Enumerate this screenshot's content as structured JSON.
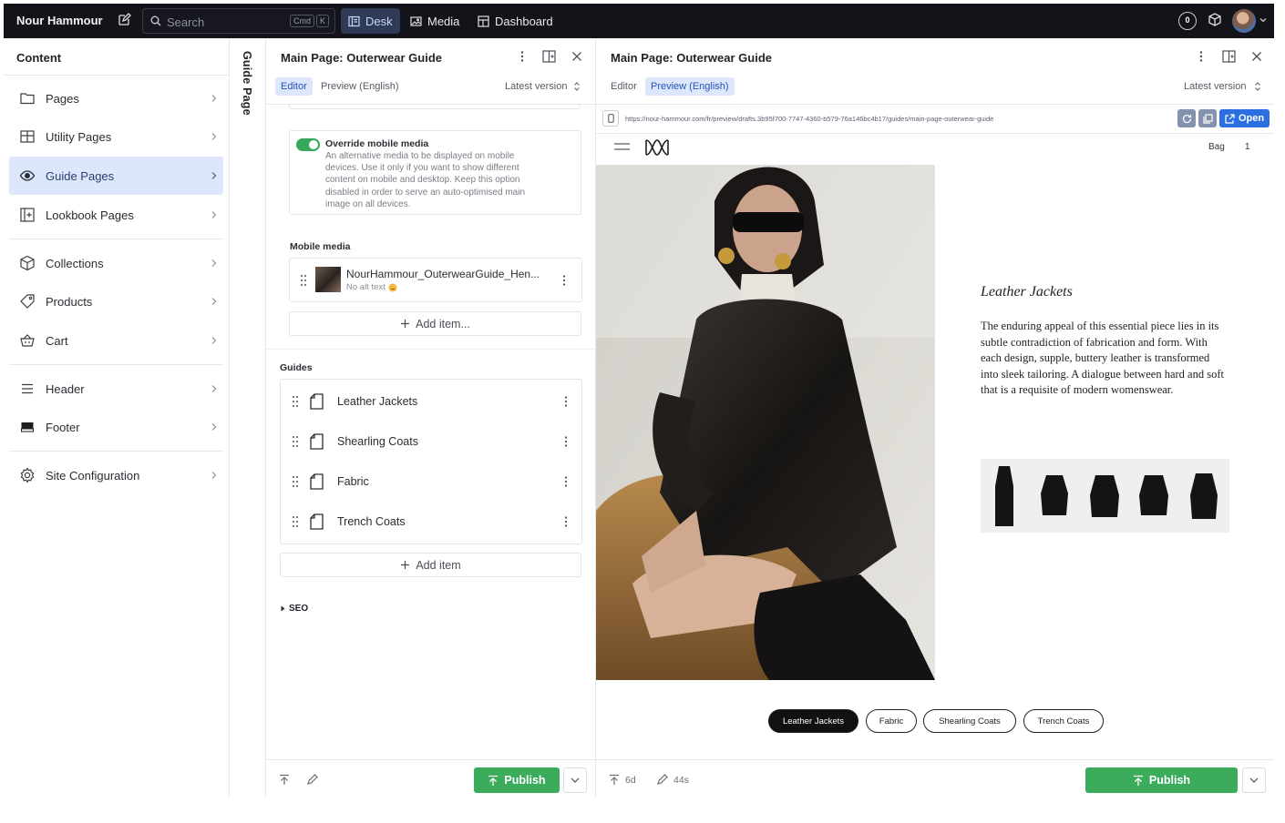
{
  "topbar": {
    "brand": "Nour Hammour",
    "search_placeholder": "Search",
    "kbd": [
      "Cmd",
      "K"
    ],
    "nav": [
      {
        "label": "Desk",
        "icon": "desk-icon",
        "active": true
      },
      {
        "label": "Media",
        "icon": "image-icon",
        "active": false
      },
      {
        "label": "Dashboard",
        "icon": "dashboard-icon",
        "active": false
      }
    ],
    "notification_count": "0"
  },
  "sidebar": {
    "title": "Content",
    "items": [
      {
        "label": "Pages",
        "icon": "folder-icon"
      },
      {
        "label": "Utility Pages",
        "icon": "grid-icon"
      },
      {
        "label": "Guide Pages",
        "icon": "eye-icon",
        "active": true
      },
      {
        "label": "Lookbook Pages",
        "icon": "add-panel-icon"
      },
      {
        "label": "Collections",
        "icon": "cube-icon"
      },
      {
        "label": "Products",
        "icon": "tag-icon"
      },
      {
        "label": "Cart",
        "icon": "basket-icon"
      },
      {
        "label": "Header",
        "icon": "menu-icon"
      },
      {
        "label": "Footer",
        "icon": "footer-icon"
      },
      {
        "label": "Site Configuration",
        "icon": "gear-icon"
      }
    ]
  },
  "strip": {
    "label": "Guide Page"
  },
  "editor": {
    "title": "Main Page: Outerwear Guide",
    "tabs": [
      "Editor",
      "Preview (English)"
    ],
    "version": "Latest version",
    "override": {
      "label": "Override mobile media",
      "description": "An alternative media to be displayed on mobile devices. Use it only if you want to show different content on mobile and desktop. Keep this option disabled in order to serve an auto-optimised main image on all devices."
    },
    "mobile_media": {
      "label": "Mobile media",
      "filename": "NourHammour_OuterwearGuide_Hen...",
      "alt_text": "No alt text",
      "add_label": "Add item..."
    },
    "guides": {
      "label": "Guides",
      "items": [
        "Leather Jackets",
        "Shearling Coats",
        "Fabric",
        "Trench Coats"
      ],
      "add_label": "Add item"
    },
    "seo_label": "SEO",
    "publish_label": "Publish"
  },
  "preview": {
    "title": "Main Page: Outerwear Guide",
    "tabs": [
      "Editor",
      "Preview (English)"
    ],
    "version": "Latest version",
    "url": "https://nour-hammour.com/fr/preview/drafts.3b95f700-7747-4360-b579-76a146bc4b17/guides/main-page-outerwear-guide",
    "open_label": "Open",
    "site": {
      "bag_label": "Bag",
      "bag_count": "1",
      "heading": "Leather Jackets",
      "body": "The enduring appeal of this essential piece lies in its subtle contradiction of fabrication and form. With each design, supple, buttery leather is transformed into sleek tailoring. A dialogue between hard and soft that is a requisite of modern womenswear.",
      "pills": [
        "Leather Jackets",
        "Fabric",
        "Shearling Coats",
        "Trench Coats"
      ]
    },
    "footer": {
      "published_ago": "6d",
      "edited_ago": "44s",
      "publish_label": "Publish"
    }
  },
  "colors": {
    "accent": "#2553b8",
    "publish": "#3bab5c",
    "topbar": "#13141a",
    "selected": "#dde7fb"
  }
}
